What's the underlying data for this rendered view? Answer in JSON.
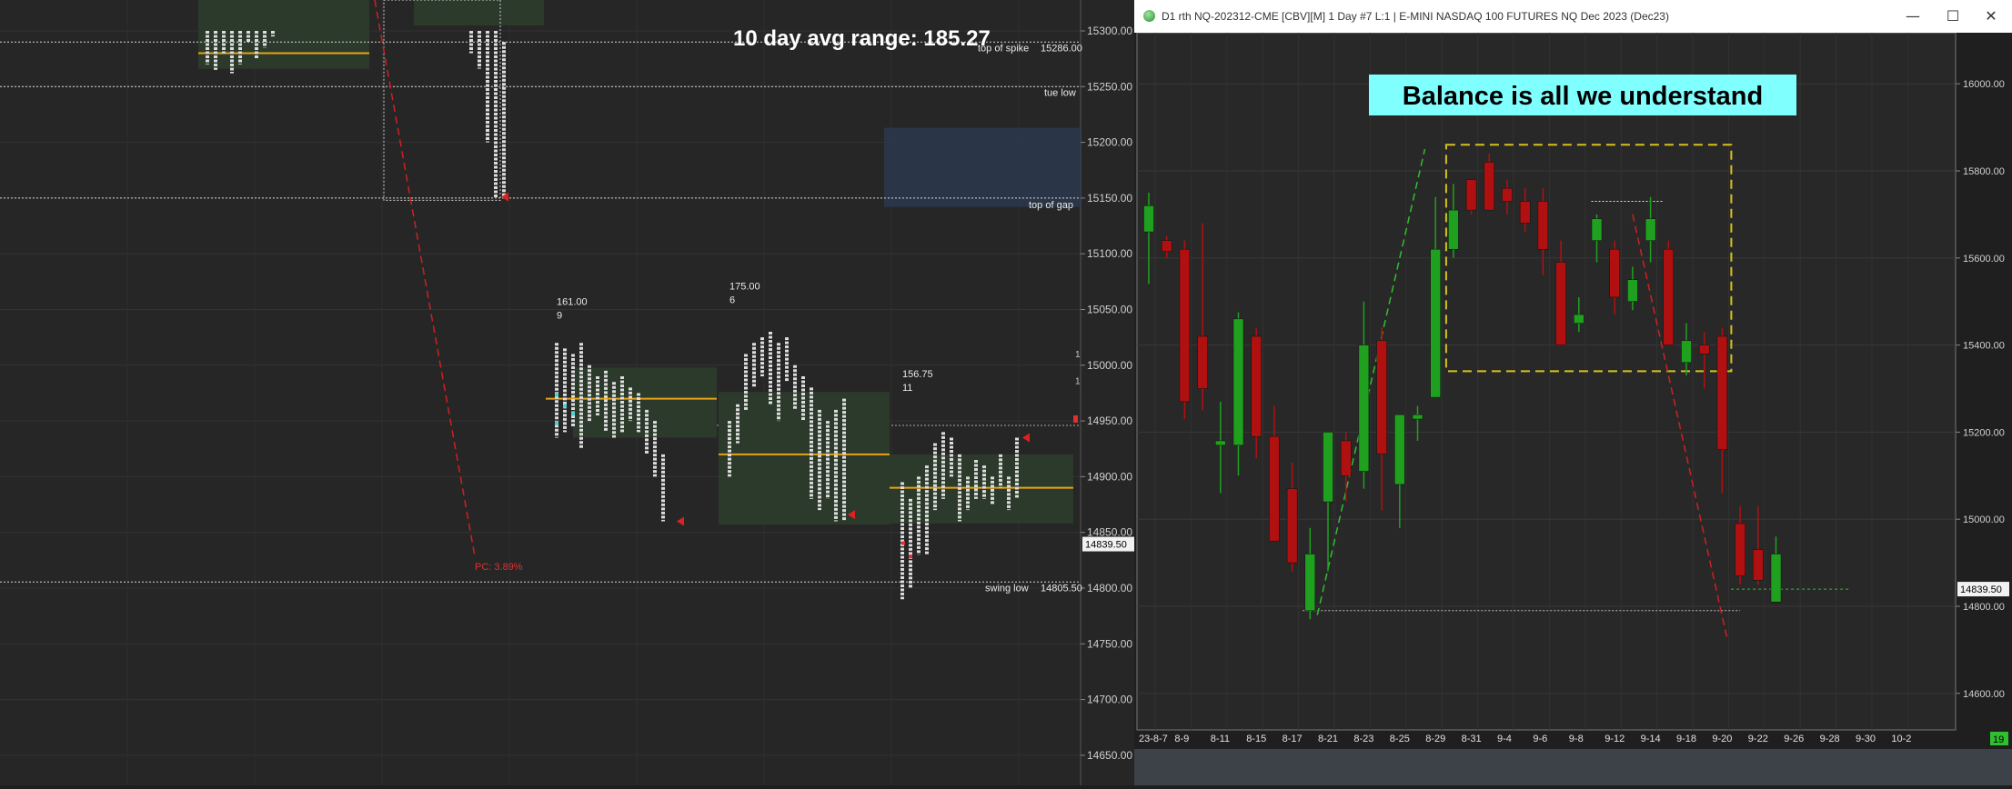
{
  "tpo_chart": {
    "headline": "10 day avg range:  185.27",
    "price_axis": [
      "15300.00",
      "15250.00",
      "15200.00",
      "15150.00",
      "15100.00",
      "15050.00",
      "15000.00",
      "14950.00",
      "14900.00",
      "14850.00",
      "14800.00",
      "14750.00",
      "14700.00",
      "14650.00"
    ],
    "annotations": {
      "top_of_spike": "top of spike",
      "top_of_spike_price": "15286.00",
      "tue_low": "tue low",
      "top_of_gap": "top of gap",
      "swing_low": "swing low",
      "swing_low_price": "14805.50",
      "pc": "PC: 3.89%"
    },
    "profile_stats": [
      {
        "range": "161.00",
        "count": "9"
      },
      {
        "range": "175.00",
        "count": "6"
      },
      {
        "range": "156.75",
        "count": "11"
      }
    ],
    "last_price": "14839.50",
    "edge_marks": [
      "1",
      "1"
    ],
    "colors": {
      "background": "#262626",
      "poc": "#e8a317",
      "value_area": "#2b3a2b",
      "annotation": "#e03030",
      "gap_zone": "#2c3a4d"
    }
  },
  "daily_window": {
    "title": "D1 rth NQ-202312-CME [CBV][M]  1 Day  #7 L:1 | E-MINI NASDAQ 100 FUTURES NQ Dec 2023 (Dec23)",
    "controls": {
      "minimize": "—",
      "maximize": "☐",
      "close": "✕"
    },
    "banner": "Balance is all we understand",
    "last_price": "14839.50",
    "corner_badge": "19",
    "colors": {
      "up": "#1fa11f",
      "down": "#b01010",
      "banner_bg": "#80ffff",
      "balance_box": "#d6c11e"
    }
  },
  "chart_data": [
    {
      "type": "tpo_profile",
      "y_unit": "price",
      "ylim": [
        14625,
        15325
      ],
      "profiles": [
        {
          "label": "161.00 / 9",
          "low": 14935,
          "high": 15040,
          "poc": 14970
        },
        {
          "label": "175.00 / 6",
          "low": 14855,
          "high": 15030,
          "poc": 14920
        },
        {
          "label": "156.75 / 11",
          "low": 14790,
          "high": 14945,
          "poc": 14890
        }
      ],
      "levels": [
        {
          "name": "top of spike",
          "price": 15286.0
        },
        {
          "name": "tue low",
          "price": 15250
        },
        {
          "name": "top of gap",
          "price": 15150
        },
        {
          "name": "swing low",
          "price": 14805.5
        }
      ]
    },
    {
      "type": "candlestick",
      "ylim": [
        14540,
        16180
      ],
      "y_ticks": [
        16000,
        15800,
        15600,
        15400,
        15200,
        15000,
        14800,
        14600
      ],
      "x_labels": [
        "23-8-7",
        "8-9",
        "8-11",
        "8-15",
        "8-17",
        "8-21",
        "8-23",
        "8-25",
        "8-29",
        "8-31",
        "9-4",
        "9-6",
        "9-8",
        "9-12",
        "9-14",
        "9-18",
        "9-20",
        "9-22",
        "9-26",
        "9-28",
        "9-30",
        "10-2"
      ],
      "candles": [
        {
          "o": 15660,
          "h": 15750,
          "l": 15540,
          "c": 15720
        },
        {
          "o": 15640,
          "h": 15650,
          "l": 15600,
          "c": 15615
        },
        {
          "o": 15620,
          "h": 15640,
          "l": 15230,
          "c": 15270
        },
        {
          "o": 15420,
          "h": 15680,
          "l": 15250,
          "c": 15300
        },
        {
          "o": 15170,
          "h": 15270,
          "l": 15060,
          "c": 15180
        },
        {
          "o": 15170,
          "h": 15475,
          "l": 15100,
          "c": 15460
        },
        {
          "o": 15420,
          "h": 15440,
          "l": 15140,
          "c": 15190
        },
        {
          "o": 15190,
          "h": 15260,
          "l": 14980,
          "c": 14950
        },
        {
          "o": 15070,
          "h": 15130,
          "l": 14880,
          "c": 14900
        },
        {
          "o": 14790,
          "h": 14980,
          "l": 14770,
          "c": 14920
        },
        {
          "o": 15040,
          "h": 15180,
          "l": 14880,
          "c": 15200
        },
        {
          "o": 15180,
          "h": 15200,
          "l": 15040,
          "c": 15100
        },
        {
          "o": 15110,
          "h": 15500,
          "l": 15070,
          "c": 15400
        },
        {
          "o": 15410,
          "h": 15440,
          "l": 15020,
          "c": 15150
        },
        {
          "o": 15080,
          "h": 15220,
          "l": 14980,
          "c": 15240
        },
        {
          "o": 15230,
          "h": 15260,
          "l": 15180,
          "c": 15240
        },
        {
          "o": 15280,
          "h": 15740,
          "l": 15280,
          "c": 15620
        },
        {
          "o": 15620,
          "h": 15770,
          "l": 15600,
          "c": 15710
        },
        {
          "o": 15780,
          "h": 15780,
          "l": 15700,
          "c": 15710
        },
        {
          "o": 15820,
          "h": 15840,
          "l": 15720,
          "c": 15710
        },
        {
          "o": 15760,
          "h": 15780,
          "l": 15700,
          "c": 15730
        },
        {
          "o": 15730,
          "h": 15760,
          "l": 15660,
          "c": 15680
        },
        {
          "o": 15730,
          "h": 15760,
          "l": 15560,
          "c": 15620
        },
        {
          "o": 15590,
          "h": 15640,
          "l": 15400,
          "c": 15400
        },
        {
          "o": 15450,
          "h": 15510,
          "l": 15430,
          "c": 15470
        },
        {
          "o": 15640,
          "h": 15700,
          "l": 15590,
          "c": 15690
        },
        {
          "o": 15620,
          "h": 15640,
          "l": 15470,
          "c": 15510
        },
        {
          "o": 15500,
          "h": 15580,
          "l": 15480,
          "c": 15550
        },
        {
          "o": 15640,
          "h": 15740,
          "l": 15590,
          "c": 15690
        },
        {
          "o": 15620,
          "h": 15640,
          "l": 15400,
          "c": 15400
        },
        {
          "o": 15360,
          "h": 15450,
          "l": 15330,
          "c": 15410
        },
        {
          "o": 15400,
          "h": 15430,
          "l": 15300,
          "c": 15380
        },
        {
          "o": 15420,
          "h": 15440,
          "l": 15060,
          "c": 15160
        },
        {
          "o": 14990,
          "h": 15030,
          "l": 14850,
          "c": 14870
        },
        {
          "o": 14930,
          "h": 15030,
          "l": 14850,
          "c": 14860
        },
        {
          "o": 14810,
          "h": 14960,
          "l": 14810,
          "c": 14920
        }
      ],
      "annotations": {
        "balance_box": {
          "y_top": 15860,
          "y_bottom": 15340
        },
        "support_line": 14790,
        "last_price_line": 14839.5
      }
    }
  ]
}
